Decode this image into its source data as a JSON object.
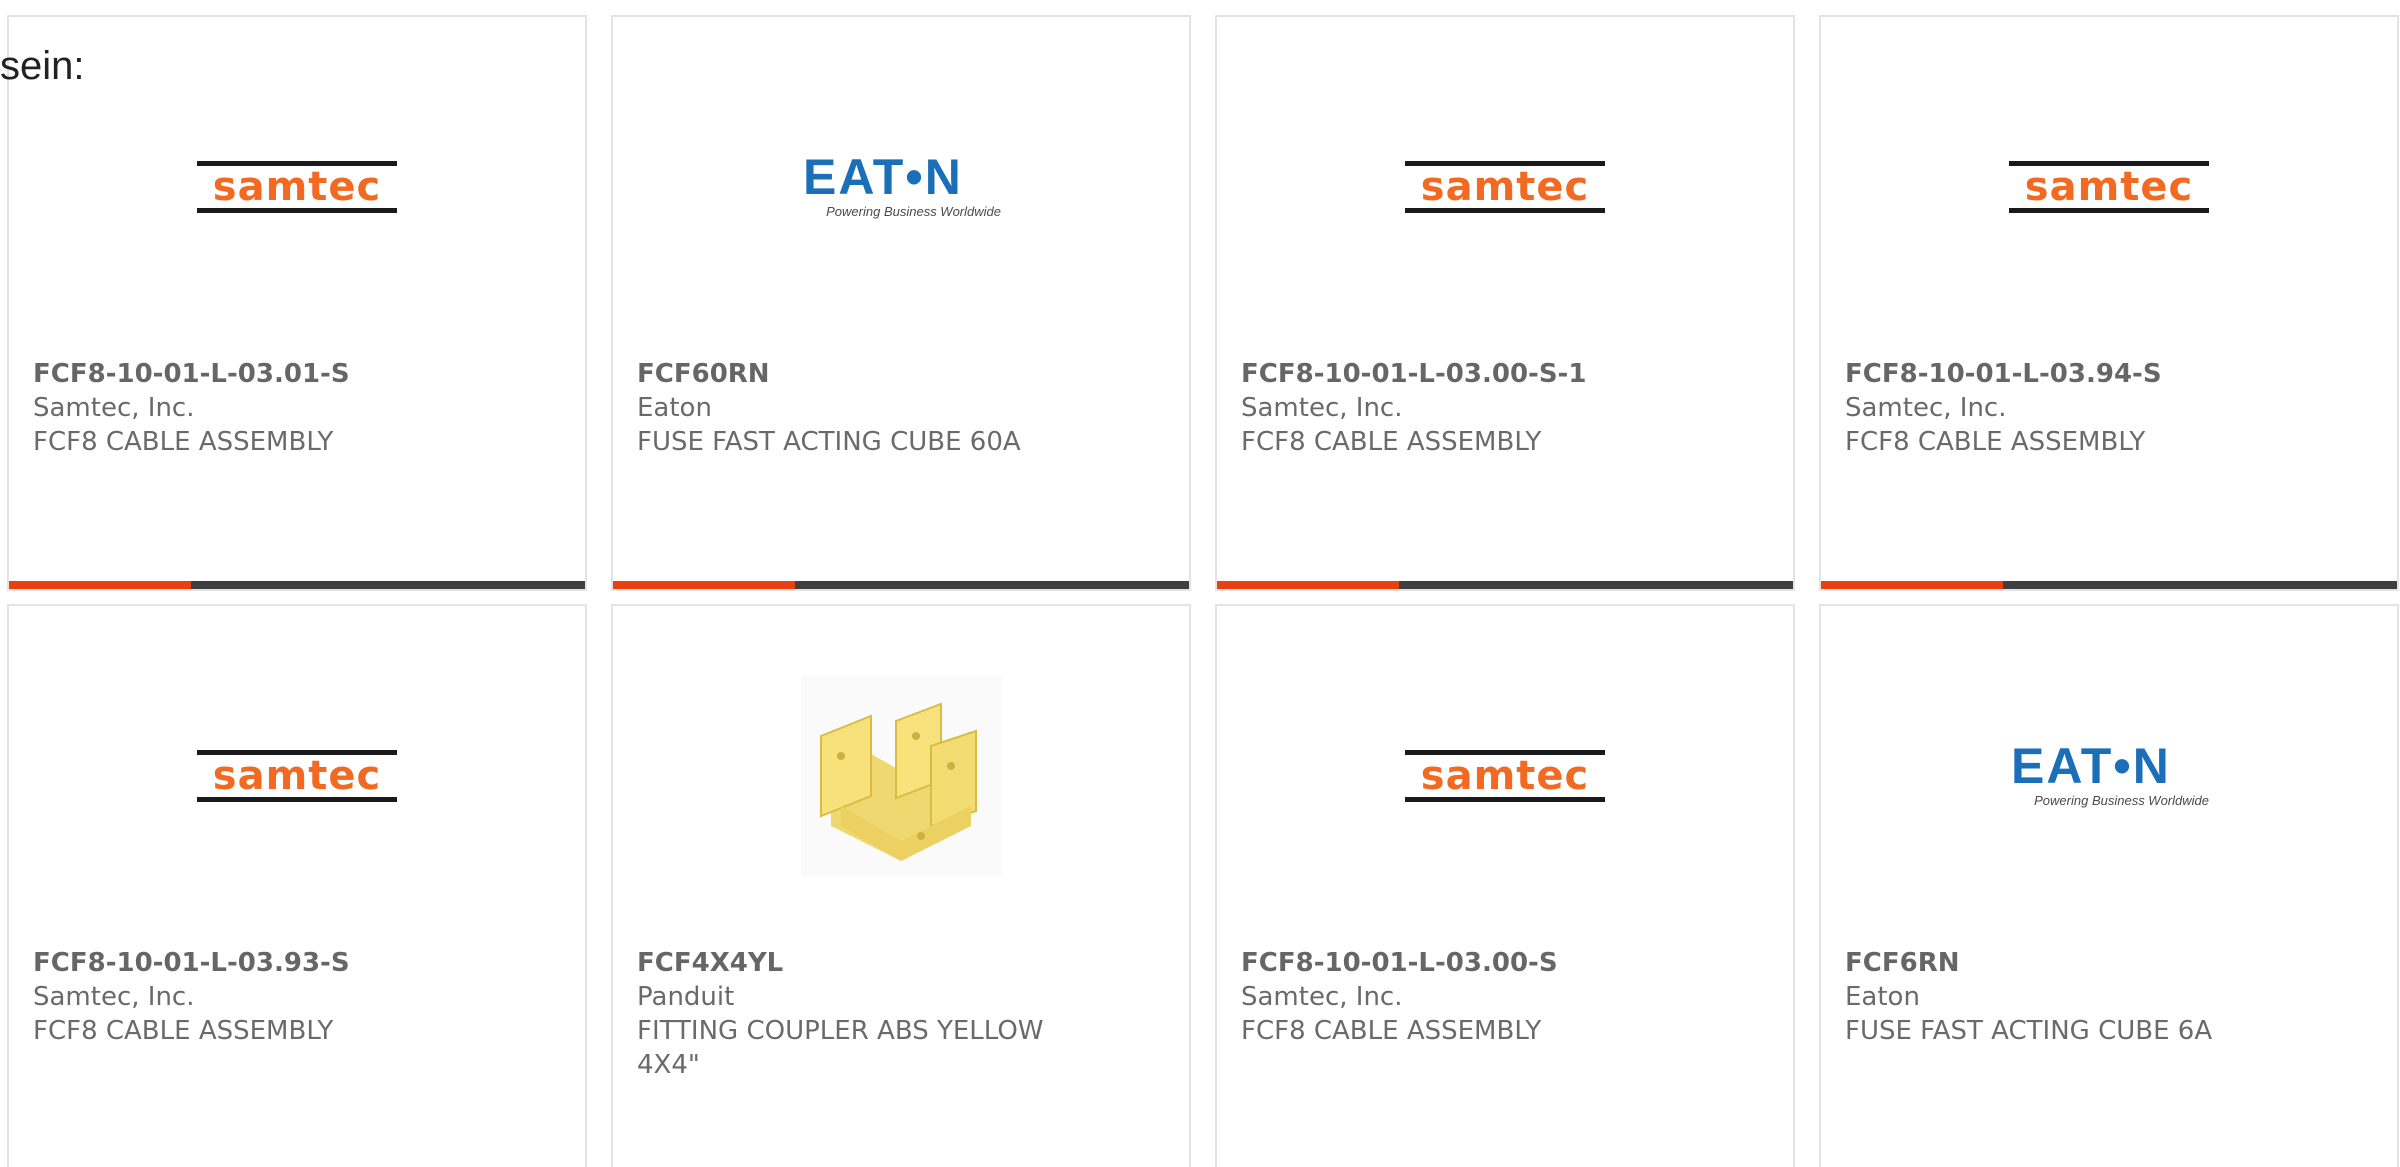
{
  "intro_text": "sein:",
  "accent_color": "#e84010",
  "bar_color": "#3f3f3f",
  "products": [
    {
      "part": "FCF8-10-01-L-03.01-S",
      "manufacturer": "Samtec, Inc.",
      "description": "FCF8 CABLE ASSEMBLY",
      "logo": "samtec-logo",
      "logo_text": "samtec"
    },
    {
      "part": "FCF60RN",
      "manufacturer": "Eaton",
      "description": "FUSE FAST ACTING CUBE 60A",
      "logo": "eaton-logo",
      "logo_text": "EAT•N",
      "logo_tagline": "Powering Business Worldwide"
    },
    {
      "part": "FCF8-10-01-L-03.00-S-1",
      "manufacturer": "Samtec, Inc.",
      "description": "FCF8 CABLE ASSEMBLY",
      "logo": "samtec-logo",
      "logo_text": "samtec"
    },
    {
      "part": "FCF8-10-01-L-03.94-S",
      "manufacturer": "Samtec, Inc.",
      "description": "FCF8 CABLE ASSEMBLY",
      "logo": "samtec-logo",
      "logo_text": "samtec"
    },
    {
      "part": "FCF8-10-01-L-03.93-S",
      "manufacturer": "Samtec, Inc.",
      "description": "FCF8 CABLE ASSEMBLY",
      "logo": "samtec-logo",
      "logo_text": "samtec"
    },
    {
      "part": "FCF4X4YL",
      "manufacturer": "Panduit",
      "description": "FITTING COUPLER ABS YELLOW 4X4\"",
      "logo": "coupler-image"
    },
    {
      "part": "FCF8-10-01-L-03.00-S",
      "manufacturer": "Samtec, Inc.",
      "description": "FCF8 CABLE ASSEMBLY",
      "logo": "samtec-logo",
      "logo_text": "samtec"
    },
    {
      "part": "FCF6RN",
      "manufacturer": "Eaton",
      "description": "FUSE FAST ACTING CUBE 6A",
      "logo": "eaton-logo",
      "logo_text": "EAT•N",
      "logo_tagline": "Powering Business Worldwide"
    }
  ]
}
